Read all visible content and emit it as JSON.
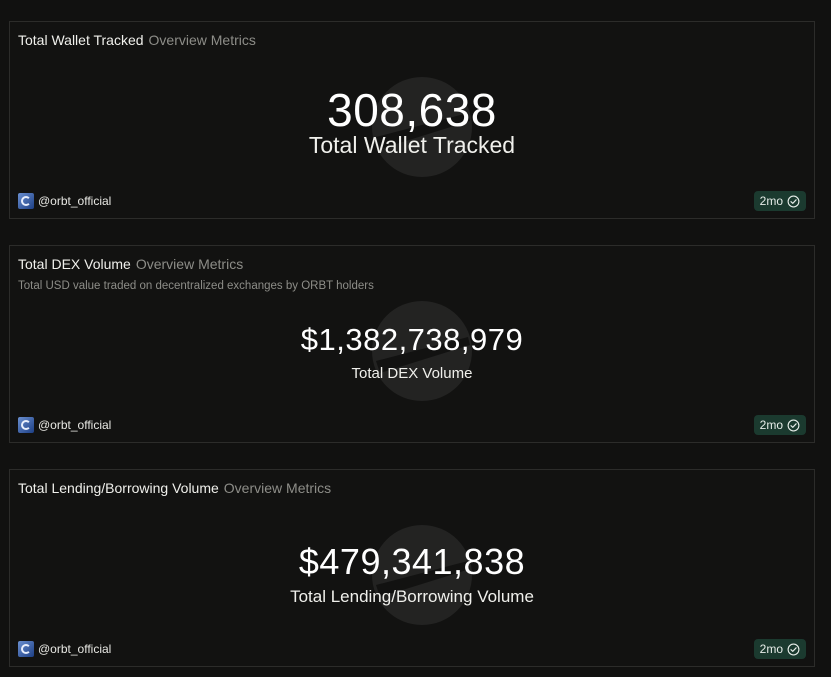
{
  "cards": [
    {
      "title": "Total Wallet Tracked",
      "category": "Overview Metrics",
      "description": "",
      "value": "308,638",
      "label": "Total Wallet Tracked",
      "author": "@orbt_official",
      "age": "2mo"
    },
    {
      "title": "Total DEX Volume",
      "category": "Overview Metrics",
      "description": "Total USD value traded on decentralized exchanges by ORBT holders",
      "value": "$1,382,738,979",
      "label": "Total DEX Volume",
      "author": "@orbt_official",
      "age": "2mo"
    },
    {
      "title": "Total Lending/Borrowing Volume",
      "category": "Overview Metrics",
      "description": "",
      "value": "$479,341,838",
      "label": "Total Lending/Borrowing Volume",
      "author": "@orbt_official",
      "age": "2mo"
    }
  ],
  "colors": {
    "background": "#111110",
    "card_border": "#2c2c2a",
    "muted_text": "#8d8d88",
    "badge_bg": "#1b3a2f"
  },
  "icons": {
    "avatar": "orbt-logo-icon",
    "verified": "check-circle-icon",
    "watermark": "dune-watermark-icon"
  }
}
